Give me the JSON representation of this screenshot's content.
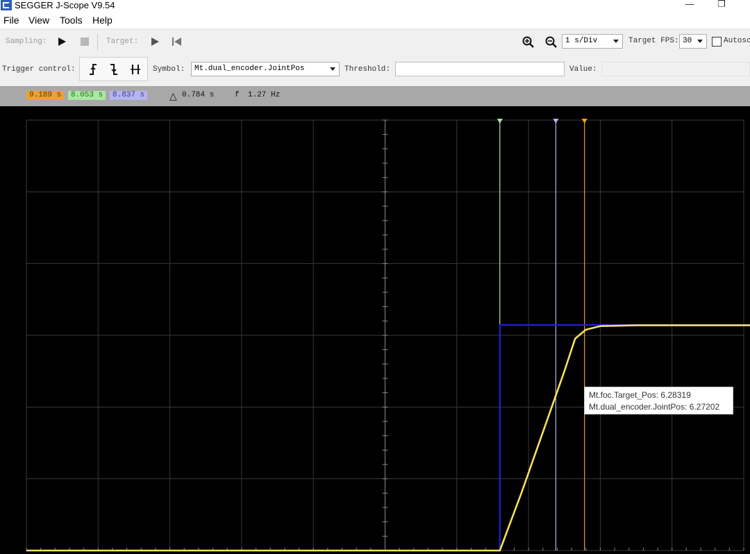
{
  "window": {
    "title": "SEGGER J-Scope V9.54",
    "minimize_glyph": "—",
    "maximize_glyph": "❐"
  },
  "menu": [
    "File",
    "View",
    "Tools",
    "Help"
  ],
  "toolbar": {
    "sampling_label": "Sampling:",
    "target_label": "Target:",
    "timebase": "1 s/Div",
    "target_fps_label": "Target FPS:",
    "target_fps": "30",
    "autoscale_label": "Autosc"
  },
  "trigger": {
    "label": "Trigger control:",
    "rising_glyph": "⨍",
    "symbol_label": "Symbol:",
    "symbol_value": "Mt.dual_encoder.JointPos",
    "threshold_label": "Threshold:",
    "threshold_value": "",
    "value_label": "Value:",
    "value_value": ""
  },
  "cursors": {
    "c1": "9.189 s",
    "c2": "8.053 s",
    "c3": "8.837 s",
    "delta_symbol": "△",
    "delta": "0.784 s",
    "freq_symbol": "f",
    "freq": "1.27 Hz",
    "colors": {
      "c1": "#f0a030",
      "c2": "#a8e8a0",
      "c3": "#b4b4f0"
    }
  },
  "tooltip": {
    "line1": "Mt.foc.Target_Pos: 6.28319",
    "line2": "Mt.dual_encoder.JointPos: 6.27202"
  },
  "chart_data": {
    "type": "line",
    "title": "",
    "xlabel": "",
    "ylabel": "",
    "grid": true,
    "divisions": {
      "x": 10,
      "y": 6
    },
    "x_unit_per_div": "1 s/Div",
    "series": [
      {
        "name": "Mt.foc.Target_Pos",
        "color": "#2020d8",
        "points": [
          [
            0,
            0
          ],
          [
            6.6,
            0
          ],
          [
            6.6,
            6.28319
          ],
          [
            10.3,
            6.28319
          ]
        ]
      },
      {
        "name": "Mt.dual_encoder.JointPos",
        "color": "#f5e15a",
        "points": [
          [
            0,
            0
          ],
          [
            6.6,
            0
          ],
          [
            6.9,
            1.6
          ],
          [
            7.2,
            3.3
          ],
          [
            7.5,
            5.0
          ],
          [
            7.65,
            5.9
          ],
          [
            7.8,
            6.15
          ],
          [
            8.0,
            6.25
          ],
          [
            8.5,
            6.27202
          ],
          [
            10.3,
            6.27202
          ]
        ]
      }
    ],
    "cursors": [
      {
        "x": 6.6,
        "color": "#a8e8a0"
      },
      {
        "x": 7.38,
        "color": "#b4b4f0"
      },
      {
        "x": 7.78,
        "color": "#f0a030"
      }
    ]
  }
}
